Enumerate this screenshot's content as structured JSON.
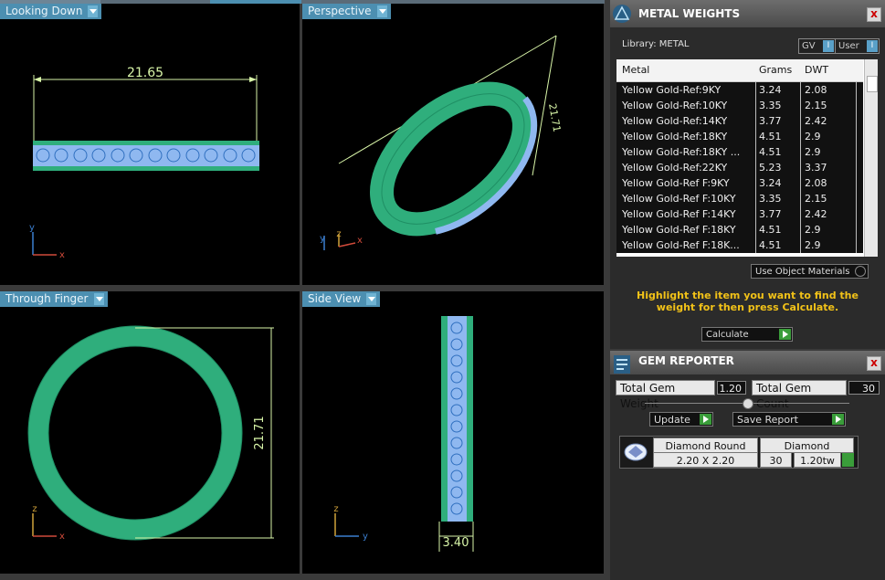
{
  "viewports": {
    "top_left": {
      "label": "Looking Down",
      "dimension": "21.65",
      "axes": {
        "a": "y",
        "b": "x"
      }
    },
    "top_right": {
      "label": "Perspective",
      "dimension": "21.71",
      "axes": {
        "a": "y",
        "b": "z",
        "c": "x"
      }
    },
    "bottom_left": {
      "label": "Through Finger",
      "dimension": "21.71",
      "axes": {
        "a": "z",
        "b": "x"
      }
    },
    "bottom_right": {
      "label": "Side View",
      "dimension": "3.40",
      "axes": {
        "a": "z",
        "b": "y"
      }
    }
  },
  "metal_weights": {
    "title": "METAL WEIGHTS",
    "close": "x",
    "library_label": "Library: METAL",
    "gv_label": "GV",
    "user_label": "User",
    "toggle_mark": "I",
    "columns": [
      "Metal",
      "Grams",
      "DWT"
    ],
    "rows": [
      [
        "Yellow Gold-Ref:9KY",
        "3.24",
        "2.08"
      ],
      [
        "Yellow Gold-Ref:10KY",
        "3.35",
        "2.15"
      ],
      [
        "Yellow Gold-Ref:14KY",
        "3.77",
        "2.42"
      ],
      [
        "Yellow Gold-Ref:18KY",
        "4.51",
        "2.9"
      ],
      [
        "Yellow Gold-Ref:18KY ...",
        "4.51",
        "2.9"
      ],
      [
        "Yellow Gold-Ref:22KY",
        "5.23",
        "3.37"
      ],
      [
        "Yellow Gold-Ref F:9KY",
        "3.24",
        "2.08"
      ],
      [
        "Yellow Gold-Ref F:10KY",
        "3.35",
        "2.15"
      ],
      [
        "Yellow Gold-Ref F:14KY",
        "3.77",
        "2.42"
      ],
      [
        "Yellow Gold-Ref F:18KY",
        "4.51",
        "2.9"
      ],
      [
        "Yellow Gold-Ref F:18K...",
        "4.51",
        "2.9"
      ]
    ],
    "use_object_materials": "Use Object Materials",
    "hint": "Highlight the item you want to find the weight for then press Calculate.",
    "calculate_label": "Calculate"
  },
  "gem_reporter": {
    "title": "GEM REPORTER",
    "close": "x",
    "total_weight_label": "Total Gem Weight",
    "total_weight_value": "1.20",
    "total_count_label": "Total Gem Count",
    "total_count_value": "30",
    "update_label": "Update",
    "save_report_label": "Save Report",
    "gem_name": "Diamond Round",
    "gem_size": "2.20 X 2.20",
    "gem_type": "Diamond",
    "gem_count": "30",
    "gem_weight": "1.20tw"
  },
  "colors": {
    "accent": "#4c8fb1",
    "ring_green": "#2fae7c",
    "stone_blue": "#8fb8f0",
    "dimension_line": "#d8f5a8",
    "hint_yellow": "#f2c218"
  }
}
